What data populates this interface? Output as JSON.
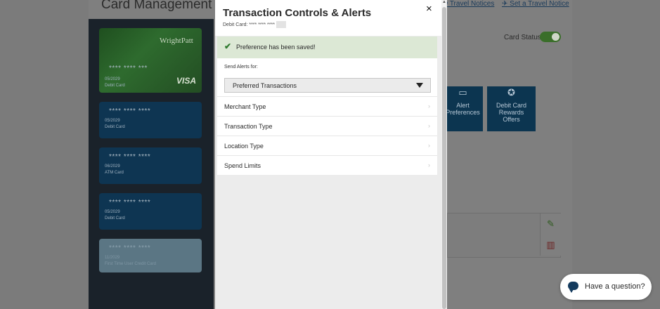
{
  "background": {
    "title": "Card Management",
    "links": [
      "w Travel Notices",
      "Set a Travel Notice"
    ],
    "card_status_label": "Card Status",
    "cards": [
      {
        "number": "**** **** ***",
        "expiry": "05/2029",
        "type": "Debit Card",
        "brand": "VISA",
        "logo": "WrightPatt"
      },
      {
        "number": "**** **** ****",
        "expiry": "05/2029",
        "type": "Debit Card"
      },
      {
        "number": "**** **** ****",
        "expiry": "06/2029",
        "type": "ATM Card"
      },
      {
        "number": "**** **** ****",
        "expiry": "05/2029",
        "type": "Debit Card"
      },
      {
        "number": "**** **** ****",
        "expiry": "11/2029",
        "type": "First Time User Credit Card"
      }
    ],
    "tiles": [
      {
        "label": "Alert\nPreferences",
        "icon": "chat-icon"
      },
      {
        "label": "Debit Card\nRewards\nOffers",
        "icon": "ribbon-icon"
      }
    ]
  },
  "modal": {
    "title": "Transaction Controls & Alerts",
    "subtitle": "Debit Card: **** **** ****",
    "close": "×",
    "success_message": "Preference has been saved!",
    "send_alerts_label": "Send Alerts for:",
    "select_value": "Preferred Transactions",
    "rows": [
      "Merchant Type",
      "Transaction Type",
      "Location Type",
      "Spend Limits"
    ]
  },
  "chat": {
    "label": "Have a question?"
  },
  "colors": {
    "success_bg": "#dce8d5",
    "check": "#2f7a2f",
    "card_blue": "#0e3552",
    "chat_bubble": "#143b5e"
  }
}
